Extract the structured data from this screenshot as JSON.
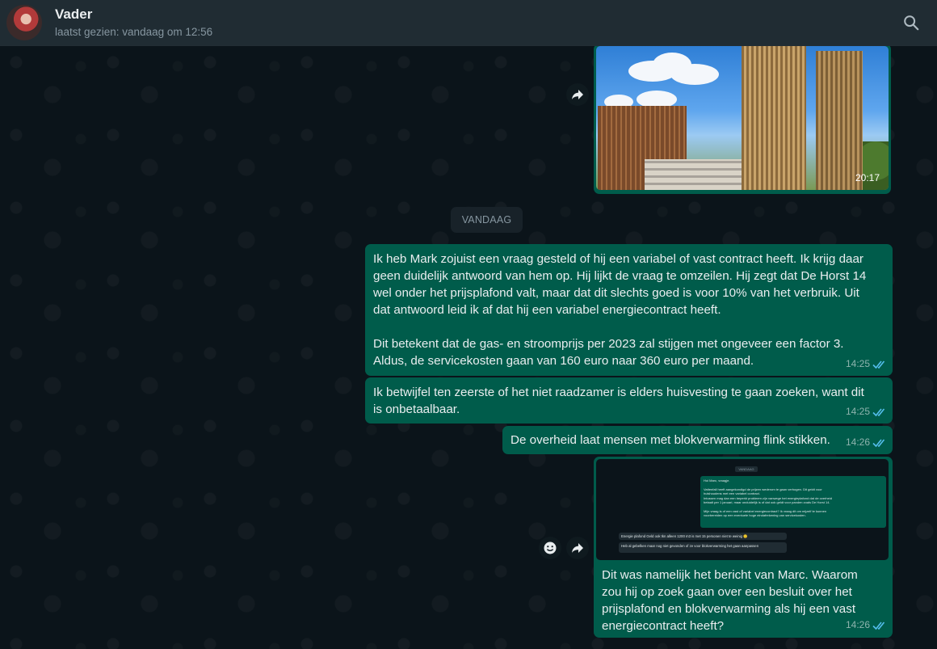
{
  "header": {
    "contact_name": "Vader",
    "status": "laatst gezien: vandaag om 12:56"
  },
  "colors": {
    "outgoing_bubble": "#005c4b",
    "background": "#0b141a",
    "header": "#202c33",
    "read_ticks": "#53bdeb"
  },
  "messages": [
    {
      "type": "image",
      "subject": "modern brown-gold towers and low building under a blue sky with clouds",
      "time": "20:17",
      "status": "read"
    },
    {
      "type": "date-divider",
      "label": "VANDAAG"
    },
    {
      "type": "text",
      "text": "Ik heb Mark zojuist een vraag gesteld of hij een variabel of vast contract heeft. Ik krijg daar\ngeen duidelijk antwoord van hem op. Hij lijkt de vraag te omzeilen. Hij zegt dat De Horst 14\nwel onder het prijsplafond valt, maar dat dit slechts goed is voor 10% van het verbruik. Uit\ndat antwoord leid ik af dat hij een variabel energiecontract heeft.\n\nDit betekent dat de gas- en stroomprijs per 2023 zal stijgen met ongeveer een factor 3.\nAldus, de servicekosten gaan van 160 euro naar 360 euro per maand.",
      "time": "14:25",
      "status": "read"
    },
    {
      "type": "text",
      "text": "Ik betwijfel ten zeerste of het niet raadzamer is elders huisvesting te gaan zoeken, want dit\nis onbetaalbaar.",
      "time": "14:25",
      "status": "read"
    },
    {
      "type": "text",
      "text": "De overheid laat mensen met blokverwarming flink stikken.",
      "time": "14:26",
      "status": "read"
    },
    {
      "type": "image-with-caption",
      "screenshot": {
        "date_label": "VANDAAG",
        "outgoing_text": "Hoi Marc, vraagje.\n\nVattenfall heeft aangekondigd de prijzen wederom te gaan verhogen. Dit geldt voor\nhuishoudens met een variabel contract.\nIntussen mag dan een beperkt probleem zijn vanwege het energieplafond dat de overheid\nbetaalt per 1 januari, maar onduidelijk is of dat ook geldt voor panden zoals De Horst 14.\n\nMijn vraag is of een vast of variabel energiecontract? Ik vraag dit om mijzelf te kunnen\nvoorbereiden op een eventuele hoge eindafrekening van servicekosten.",
        "incoming_1": "Energie plafond Geld ook tkn alleen 1200 m3  is met 15 personen niet te weinig 🙂",
        "incoming_2": "Heb al gebelken maar nog niet gevonden of ze voor blokverwarming het gaan aanpassen"
      },
      "caption": "Dit was namelijk het bericht van Marc. Waarom\nzou hij op zoek gaan over een besluit over het\nprijsplafond en blokverwarming als hij een vast\nenergiecontract heeft?",
      "time": "14:26",
      "status": "read"
    }
  ]
}
